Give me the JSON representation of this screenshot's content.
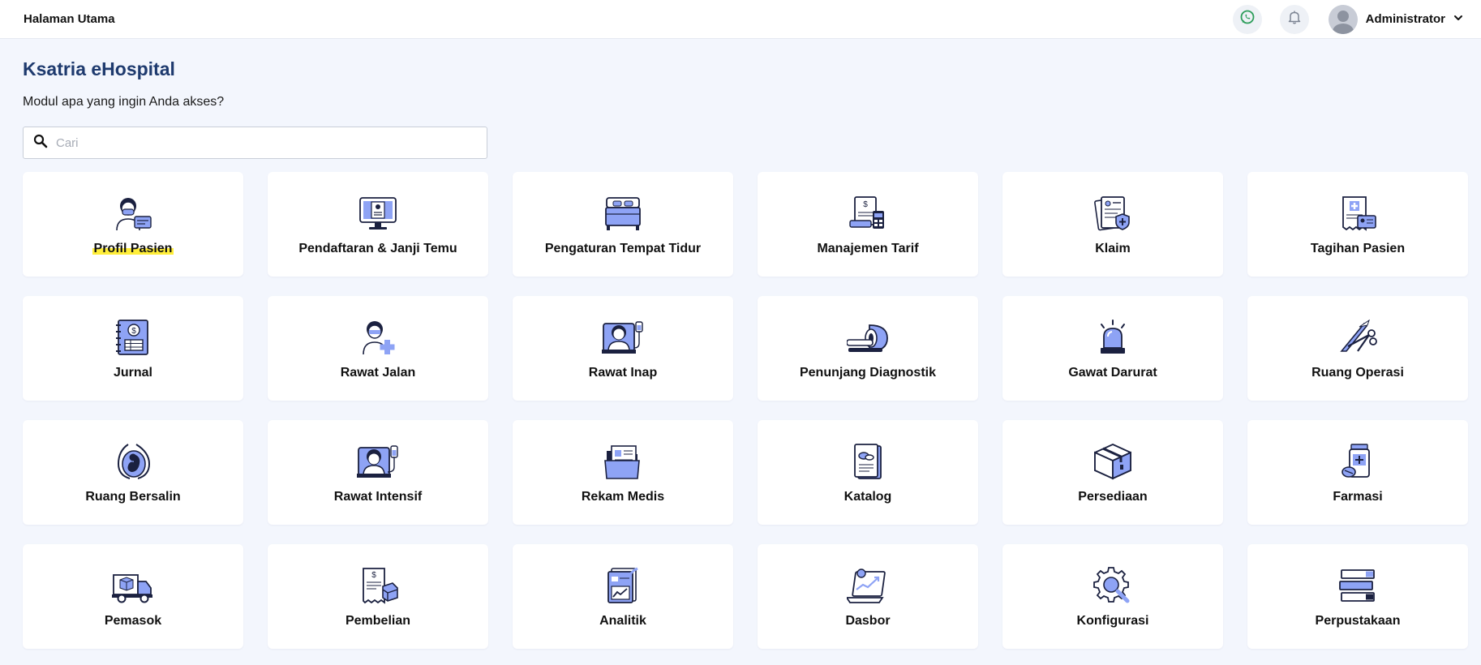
{
  "topbar": {
    "breadcrumb": "Halaman Utama",
    "user_name": "Administrator",
    "icons": [
      "whatsapp-icon",
      "bell-icon",
      "avatar",
      "chevron-down-icon"
    ]
  },
  "page": {
    "title": "Ksatria eHospital",
    "subtitle": "Modul apa yang ingin Anda akses?"
  },
  "search": {
    "placeholder": "Cari",
    "value": ""
  },
  "colors": {
    "accent": "#1e3a6e",
    "icon_fill": "#8ea3f5",
    "highlight": "#ffee3a",
    "background": "#f3f6fd"
  },
  "modules": [
    {
      "label": "Profil Pasien",
      "icon": "patient-profile-icon",
      "highlighted": true
    },
    {
      "label": "Pendaftaran & Janji Temu",
      "icon": "registration-monitor-icon"
    },
    {
      "label": "Pengaturan Tempat Tidur",
      "icon": "bed-icon"
    },
    {
      "label": "Manajemen Tarif",
      "icon": "tariff-calculator-icon"
    },
    {
      "label": "Klaim",
      "icon": "claim-document-icon"
    },
    {
      "label": "Tagihan Pasien",
      "icon": "patient-bill-icon"
    },
    {
      "label": "Jurnal",
      "icon": "journal-icon"
    },
    {
      "label": "Rawat Jalan",
      "icon": "outpatient-icon"
    },
    {
      "label": "Rawat Inap",
      "icon": "inpatient-icon"
    },
    {
      "label": "Penunjang Diagnostik",
      "icon": "ct-scanner-icon"
    },
    {
      "label": "Gawat Darurat",
      "icon": "emergency-siren-icon"
    },
    {
      "label": "Ruang Operasi",
      "icon": "surgery-tools-icon"
    },
    {
      "label": "Ruang Bersalin",
      "icon": "maternity-icon"
    },
    {
      "label": "Rawat Intensif",
      "icon": "intensive-care-icon"
    },
    {
      "label": "Rekam Medis",
      "icon": "medical-record-folder-icon"
    },
    {
      "label": "Katalog",
      "icon": "catalog-icon"
    },
    {
      "label": "Persediaan",
      "icon": "inventory-box-icon"
    },
    {
      "label": "Farmasi",
      "icon": "pharmacy-icon"
    },
    {
      "label": "Pemasok",
      "icon": "supplier-truck-icon"
    },
    {
      "label": "Pembelian",
      "icon": "purchase-receipt-icon"
    },
    {
      "label": "Analitik",
      "icon": "analytics-icon"
    },
    {
      "label": "Dasbor",
      "icon": "dashboard-laptop-icon"
    },
    {
      "label": "Konfigurasi",
      "icon": "configuration-gear-icon"
    },
    {
      "label": "Perpustakaan",
      "icon": "library-books-icon"
    }
  ]
}
